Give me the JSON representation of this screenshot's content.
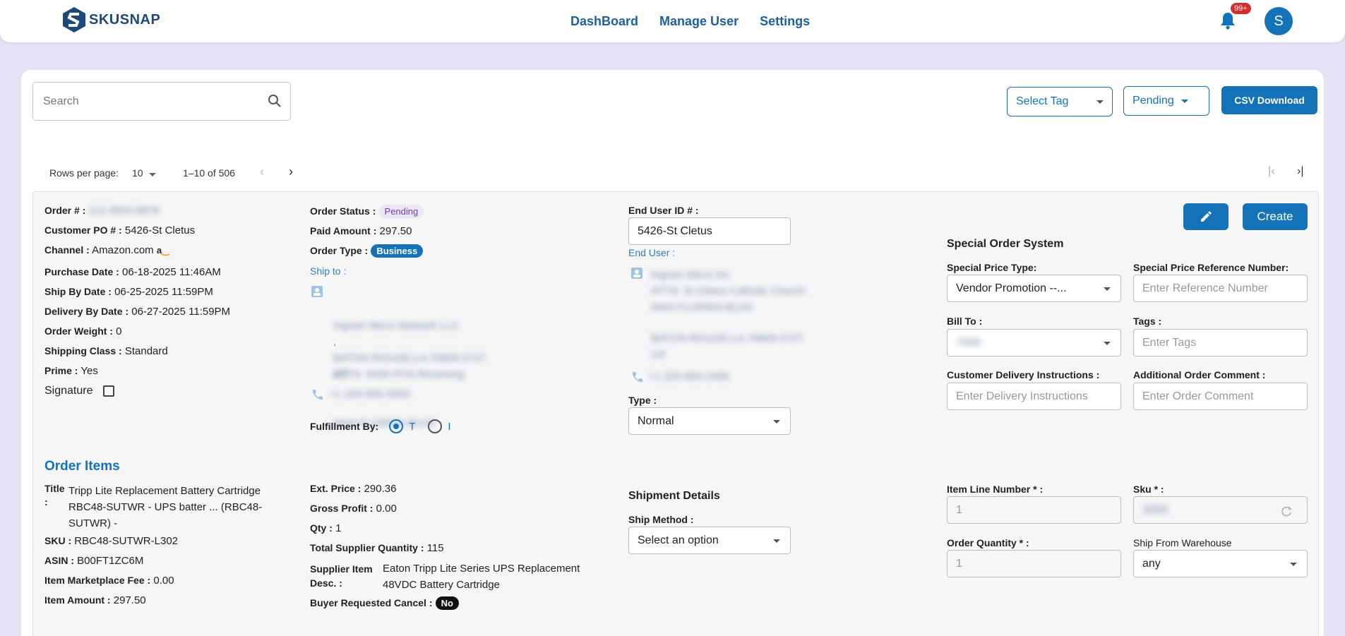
{
  "header": {
    "brand": "SKUSNAP",
    "nav": [
      "DashBoard",
      "Manage User",
      "Settings"
    ],
    "notif_count": "99+",
    "avatar_letter": "S"
  },
  "toolbar": {
    "search_placeholder": "Search",
    "select_tag": "Select Tag",
    "status_filter": "Pending",
    "csv_label": "CSV Download"
  },
  "pager": {
    "rows_label": "Rows per page:",
    "rows_value": "10",
    "range": "1–10 of 506"
  },
  "order": {
    "order_no_label": "Order # :",
    "order_no": "112-4823-8876",
    "customer_po_label": "Customer PO # :",
    "customer_po": "5426-St Cletus",
    "channel_label": "Channel :",
    "channel": "Amazon.com",
    "purchase_date_label": "Purchase Date :",
    "purchase_date": "06-18-2025 11:46AM",
    "ship_by_label": "Ship By Date :",
    "ship_by": "06-25-2025 11:59PM",
    "delivery_by_label": "Delivery By Date :",
    "delivery_by": "06-27-2025 11:59PM",
    "weight_label": "Order Weight :",
    "weight": "0",
    "shipping_class_label": "Shipping Class :",
    "shipping_class": "Standard",
    "prime_label": "Prime :",
    "prime": "Yes",
    "signature_label": "Signature",
    "status_label": "Order Status :",
    "status": "Pending",
    "paid_label": "Paid Amount :",
    "paid": "297.50",
    "type_label": "Order Type :",
    "type": "Business",
    "ship_to_label": "Ship to :",
    "ship_to_lines": [
      "Ingram Micro Network LLC",
      "ATTN: 5426 POS Receiving",
      "9444 FLORIDA BLVD",
      "",
      ",",
      "BATON ROUGE,LA,70809-2727",
      "US"
    ],
    "ship_to_phone": "+1 225-955-2000",
    "fulfillment_label": "Fulfillment By:",
    "fulfillment_options": [
      "T",
      "I"
    ],
    "end_user_id_label": "End User ID # :",
    "end_user_id": "5426-St Cletus",
    "end_user_label": "End User :",
    "end_user_lines": [
      "Ingram Micro Inc",
      "ATTN: St Cletus Catholic Church",
      "9444 FLORIDA BLVD",
      "BATON ROUGE,LA,70809-2727",
      "US"
    ],
    "end_user_phone": "+1 225-955-2400",
    "type_field_label": "Type :",
    "type_field_value": "Normal"
  },
  "special": {
    "title": "Special Order System",
    "price_type_label": "Special Price Type:",
    "price_type_value": "Vendor Promotion --...",
    "ref_label": "Special Price Reference Number:",
    "ref_placeholder": "Enter Reference Number",
    "bill_to_label": "Bill To :",
    "bill_to_value": "7000",
    "tags_label": "Tags :",
    "tags_placeholder": "Enter Tags",
    "delivery_instr_label": "Customer Delivery Instructions :",
    "delivery_instr_placeholder": "Enter Delivery Instructions",
    "comment_label": "Additional Order Comment :",
    "comment_placeholder": "Enter Order Comment",
    "create_label": "Create"
  },
  "items": {
    "title": "Order Items",
    "title_label": "Title",
    "title_colon": ":",
    "title_value_lines": [
      "Tripp Lite Replacement Battery Cartridge",
      "RBC48-SUTWR - UPS batter ... (RBC48-",
      "SUTWR) -"
    ],
    "sku_label": "SKU :",
    "sku": "RBC48-SUTWR-L302",
    "asin_label": "ASIN :",
    "asin": "B00FT1ZC6M",
    "fee_label": "Item Marketplace Fee :",
    "fee": "0.00",
    "amount_label": "Item Amount :",
    "amount": "297.50",
    "ext_label": "Ext. Price :",
    "ext": "290.36",
    "gp_label": "Gross Profit :",
    "gp": "0.00",
    "qty_label": "Qty :",
    "qty": "1",
    "tsq_label": "Total Supplier Quantity :",
    "tsq": "115",
    "supplier_desc_label_lines": [
      "Supplier Item",
      "Desc. :"
    ],
    "supplier_desc_lines": [
      "Eaton Tripp Lite Series UPS Replacement",
      "48VDC Battery Cartridge"
    ],
    "cancel_label": "Buyer Requested Cancel :",
    "cancel": "No",
    "shipment_title": "Shipment Details",
    "ship_method_label": "Ship Method :",
    "ship_method_value": "Select an option",
    "line_no_label": "Item Line Number * :",
    "line_no": "1",
    "sku_field_label": "Sku * :",
    "sku_field": "3000",
    "order_qty_label": "Order Quantity * :",
    "order_qty": "1",
    "warehouse_label": "Ship From Warehouse",
    "warehouse": "any"
  }
}
